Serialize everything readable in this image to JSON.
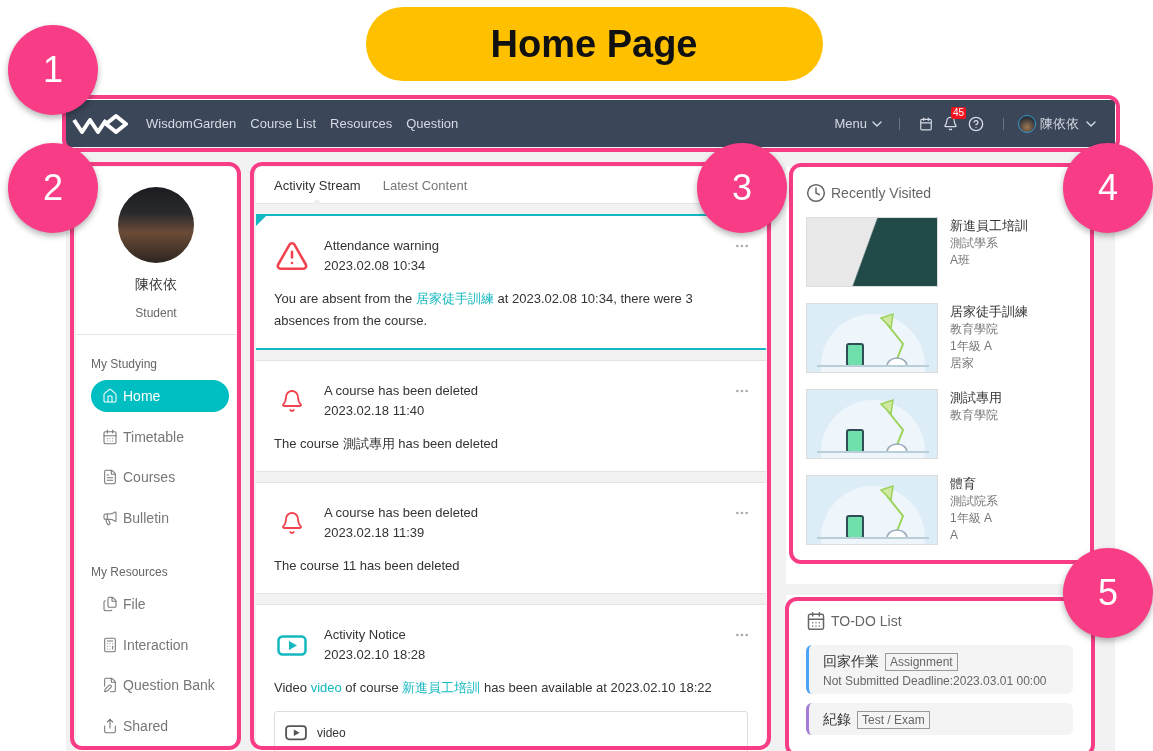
{
  "annotation": {
    "title": "Home Page",
    "callouts": [
      "1",
      "2",
      "3",
      "4",
      "5"
    ]
  },
  "navbar": {
    "links": [
      "WisdomGarden",
      "Course List",
      "Resources",
      "Question"
    ],
    "menu": "Menu",
    "notification_count": "45",
    "user_name": "陳依依"
  },
  "sidebar": {
    "name": "陳依依",
    "role": "Student",
    "sections": [
      {
        "title": "My Studying",
        "items": [
          {
            "label": "Home",
            "selected": true
          },
          {
            "label": "Timetable",
            "selected": false
          },
          {
            "label": "Courses",
            "selected": false
          },
          {
            "label": "Bulletin",
            "selected": false
          }
        ]
      },
      {
        "title": "My Resources",
        "items": [
          {
            "label": "File",
            "selected": false
          },
          {
            "label": "Interaction",
            "selected": false
          },
          {
            "label": "Question Bank",
            "selected": false
          },
          {
            "label": "Shared",
            "selected": false
          }
        ]
      }
    ]
  },
  "feed": {
    "tabs": [
      {
        "label": "Activity Stream",
        "selected": true
      },
      {
        "label": "Latest Content",
        "selected": false
      }
    ],
    "cards": [
      {
        "kind": "warning",
        "selected": true,
        "title": "Attendance warning",
        "time": "2023.02.08 10:34",
        "body": [
          {
            "text": "You are absent from the "
          },
          {
            "text": "居家徒手訓練",
            "link": true
          },
          {
            "text": " at 2023.02.08 10:34, there were 3 absences from the course."
          }
        ]
      },
      {
        "kind": "bell",
        "selected": false,
        "title": "A course has been deleted",
        "time": "2023.02.18 11:40",
        "body": [
          {
            "text": "The course 測試專用 has been deleted"
          }
        ]
      },
      {
        "kind": "bell",
        "selected": false,
        "title": "A course has been deleted",
        "time": "2023.02.18 11:39",
        "body": [
          {
            "text": "The course 11 has been deleted"
          }
        ]
      },
      {
        "kind": "video",
        "selected": false,
        "title": "Activity Notice",
        "time": "2023.02.10 18:28",
        "body": [
          {
            "text": "Video "
          },
          {
            "text": "video",
            "link": true
          },
          {
            "text": " of course "
          },
          {
            "text": "新進員工培訓",
            "link": true
          },
          {
            "text": " has been available at 2023.02.10 18:22"
          }
        ],
        "attachment": "video"
      }
    ]
  },
  "recently_visited": {
    "title": "Recently Visited",
    "items": [
      {
        "kind": "cover",
        "title": "新進員工培訓",
        "lines": [
          "測試學系",
          "A班"
        ]
      },
      {
        "kind": "default",
        "title": "居家徒手訓練",
        "lines": [
          "教育學院",
          "1年級 A",
          "居家"
        ]
      },
      {
        "kind": "default",
        "title": "測試專用",
        "lines": [
          "教育學院"
        ]
      },
      {
        "kind": "default",
        "title": "體育",
        "lines": [
          "測試院系",
          "1年級 A",
          "A"
        ]
      }
    ]
  },
  "todo": {
    "title": "TO-DO List",
    "items": [
      {
        "title": "回家作業",
        "tag": "Assignment",
        "status": "Not Submitted Deadline:2023.03.01 00:00",
        "color": "#4da3f5"
      },
      {
        "title": "紀錄",
        "tag": "Test / Exam",
        "color": "#a47bd6"
      }
    ]
  }
}
